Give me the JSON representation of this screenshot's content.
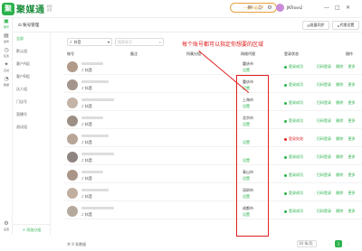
{
  "app": {
    "logo_mark": "聚",
    "name": "聚媒通",
    "logo_sub": "视频运营",
    "promo": "一键升级VIP",
    "username": "JNTrove2"
  },
  "rail": [
    {
      "icon": "▣",
      "label": "账号"
    },
    {
      "icon": "▤",
      "label": "发布"
    },
    {
      "icon": "◷",
      "label": "任务"
    },
    {
      "icon": "✦",
      "label": "互动"
    },
    {
      "icon": "◔",
      "label": "数据"
    },
    {
      "icon": "⚙",
      "label": "设置"
    }
  ],
  "header": {
    "title": "账号管理",
    "btn_sync": "批量同步",
    "btn_proxy": "代理设置"
  },
  "groups": [
    "全部",
    "默认组",
    "客户A组",
    "客户B组",
    "达人组",
    "门店号",
    "直播号",
    "测试组"
  ],
  "add_group": "+ 添加分组",
  "filter": {
    "platform": "抖音",
    "search_placeholder": "搜索账号"
  },
  "annotation": "每个账号都可以指定你想要的区域",
  "columns": [
    "账号",
    "备注",
    "所属分组",
    "网络代理",
    "登录状态",
    "操作"
  ],
  "rows": [
    {
      "platform": "抖音",
      "region": "重庆市",
      "edit": "设置",
      "status": "登录成功",
      "status_color": "#2bb24c"
    },
    {
      "platform": "抖音",
      "region": "重庆市",
      "edit": "设置",
      "status": "登录成功",
      "status_color": "#2bb24c"
    },
    {
      "platform": "抖音",
      "region": "上海市",
      "edit": "设置",
      "status": "登录成功",
      "status_color": "#2bb24c"
    },
    {
      "platform": "抖音",
      "region": "北京市",
      "edit": "设置",
      "status": "登录成功",
      "status_color": "#2bb24c"
    },
    {
      "platform": "抖音",
      "region": "",
      "edit": "设置",
      "status": "登录失效",
      "status_color": "#e02020"
    },
    {
      "platform": "抖音",
      "region": "",
      "edit": "设置",
      "status": "登录成功",
      "status_color": "#2bb24c"
    },
    {
      "platform": "抖音",
      "region": "青山市",
      "edit": "设置",
      "status": "登录成功",
      "status_color": "#2bb24c"
    },
    {
      "platform": "抖音",
      "region": "深圳市",
      "edit": "设置",
      "status": "登录成功",
      "status_color": "#2bb24c"
    },
    {
      "platform": "抖音",
      "region": "成都市",
      "edit": "设置",
      "status": "登录成功",
      "status_color": "#2bb24c"
    }
  ],
  "ops": [
    "扫码登录",
    "删除",
    "更多"
  ],
  "footer": {
    "total": "共 9 条数据",
    "page_size": "10 条/页",
    "prev": "‹",
    "page": "1",
    "next": "›"
  }
}
